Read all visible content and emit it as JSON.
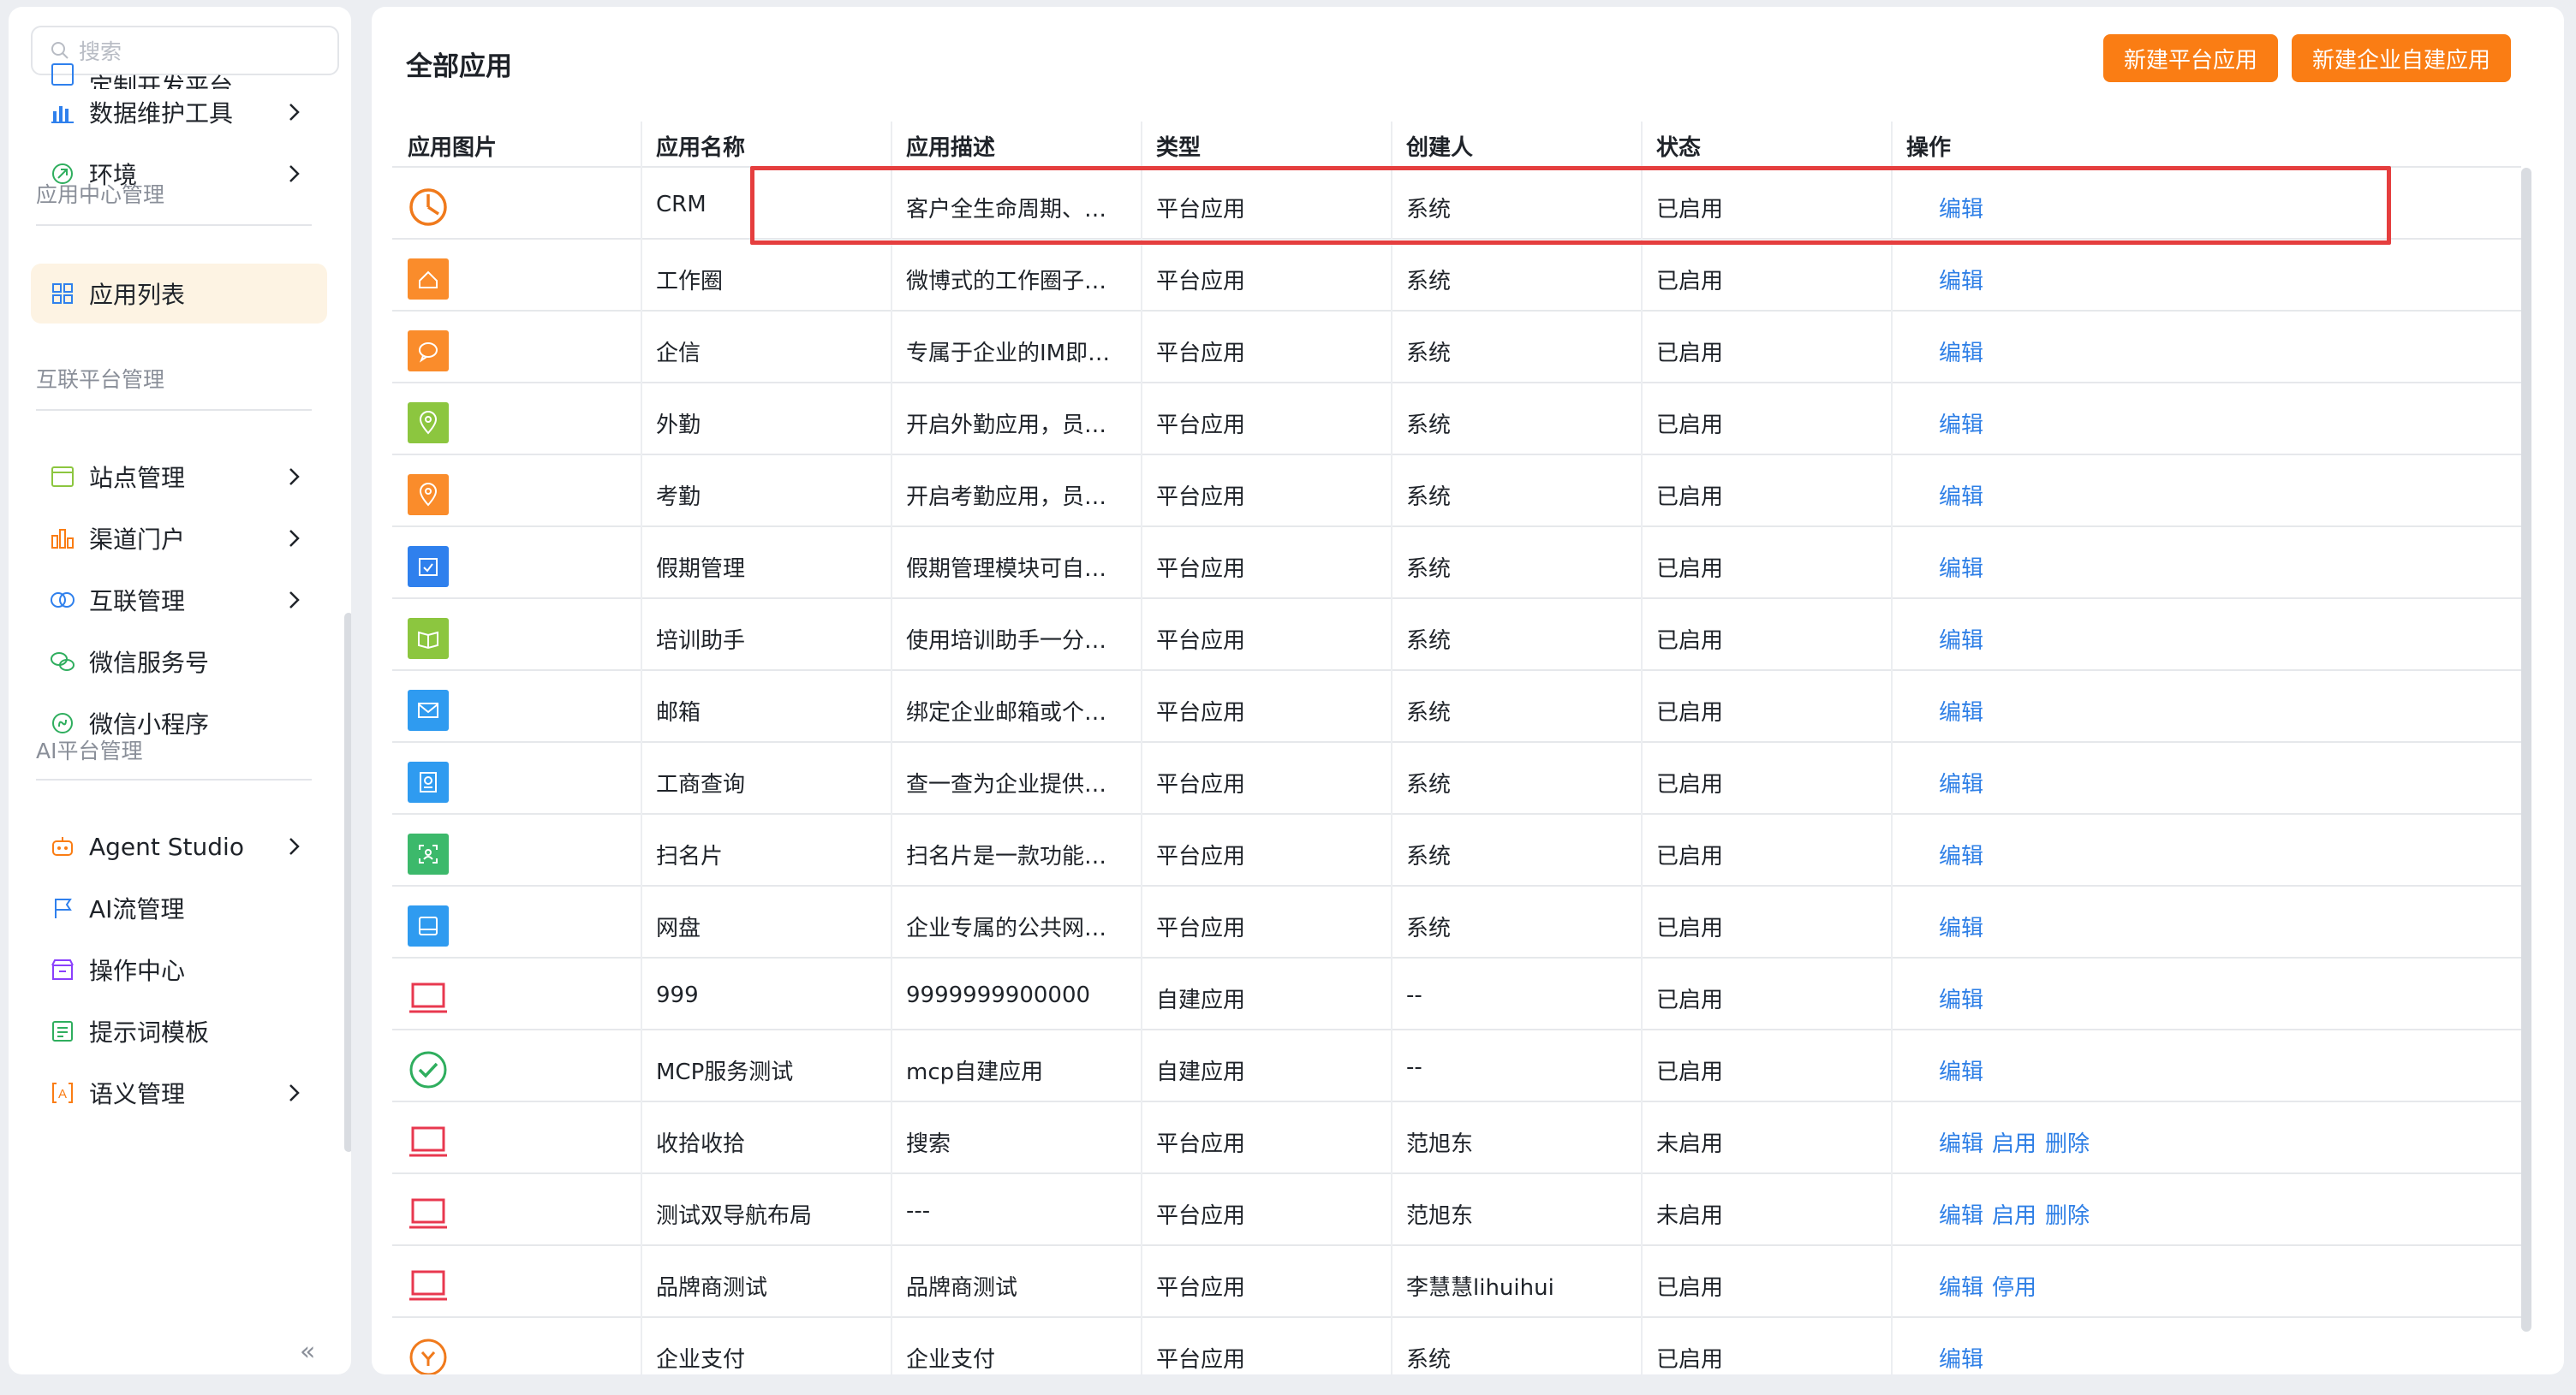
{
  "sidebar": {
    "search_placeholder": "搜索",
    "top_cut_label": "定制开发平台",
    "items_top": [
      {
        "label": "数据维护工具",
        "icon": "bar-chart-icon"
      },
      {
        "label": "环境",
        "icon": "leaf-icon"
      }
    ],
    "section_app_center": "应用中心管理",
    "app_center_items": [
      {
        "label": "应用列表",
        "icon": "grid-icon"
      }
    ],
    "section_interconnect": "互联平台管理",
    "interconnect_items": [
      {
        "label": "站点管理",
        "icon": "window-icon"
      },
      {
        "label": "渠道门户",
        "icon": "columns-icon"
      },
      {
        "label": "互联管理",
        "icon": "link-circles-icon"
      },
      {
        "label": "微信服务号",
        "icon": "wechat-icon"
      },
      {
        "label": "微信小程序",
        "icon": "mini-program-icon"
      }
    ],
    "section_ai": "AI平台管理",
    "ai_items": [
      {
        "label": "Agent Studio",
        "icon": "robot-icon"
      },
      {
        "label": "AI流管理",
        "icon": "flag-icon"
      },
      {
        "label": "操作中心",
        "icon": "store-icon"
      },
      {
        "label": "提示词模板",
        "icon": "template-icon"
      },
      {
        "label": "语义管理",
        "icon": "bracket-a-icon"
      }
    ],
    "collapse_glyph": "«"
  },
  "main": {
    "title": "全部应用",
    "btn_platform": "新建平台应用",
    "btn_enterprise": "新建企业自建应用",
    "columns": [
      "应用图片",
      "应用名称",
      "应用描述",
      "类型",
      "创建人",
      "状态",
      "操作"
    ],
    "rows": [
      {
        "icon": "pie-chart-icon",
        "color": "#f07a1c",
        "name": "CRM",
        "desc": "客户全生命周期、…",
        "type": "平台应用",
        "creator": "系统",
        "status": "已启用",
        "ops": [
          "编辑"
        ]
      },
      {
        "icon": "home-icon",
        "color": "#fa8c2b",
        "name": "工作圈",
        "desc": "微博式的工作圈子…",
        "type": "平台应用",
        "creator": "系统",
        "status": "已启用",
        "ops": [
          "编辑"
        ]
      },
      {
        "icon": "chat-icon",
        "color": "#fa8c2b",
        "name": "企信",
        "desc": "专属于企业的IM即…",
        "type": "平台应用",
        "creator": "系统",
        "status": "已启用",
        "ops": [
          "编辑"
        ]
      },
      {
        "icon": "location-icon",
        "color": "#8cc63f",
        "name": "外勤",
        "desc": "开启外勤应用，员…",
        "type": "平台应用",
        "creator": "系统",
        "status": "已启用",
        "ops": [
          "编辑"
        ]
      },
      {
        "icon": "pin-check-icon",
        "color": "#fa8c2b",
        "name": "考勤",
        "desc": "开启考勤应用，员…",
        "type": "平台应用",
        "creator": "系统",
        "status": "已启用",
        "ops": [
          "编辑"
        ]
      },
      {
        "icon": "calendar-icon",
        "color": "#2f80ed",
        "name": "假期管理",
        "desc": "假期管理模块可自…",
        "type": "平台应用",
        "creator": "系统",
        "status": "已启用",
        "ops": [
          "编辑"
        ]
      },
      {
        "icon": "book-icon",
        "color": "#8cc63f",
        "name": "培训助手",
        "desc": "使用培训助手一分…",
        "type": "平台应用",
        "creator": "系统",
        "status": "已启用",
        "ops": [
          "编辑"
        ]
      },
      {
        "icon": "mail-icon",
        "color": "#2f9bf0",
        "name": "邮箱",
        "desc": "绑定企业邮箱或个…",
        "type": "平台应用",
        "creator": "系统",
        "status": "已启用",
        "ops": [
          "编辑"
        ]
      },
      {
        "icon": "document-search-icon",
        "color": "#2f9bf0",
        "name": "工商查询",
        "desc": "查一查为企业提供…",
        "type": "平台应用",
        "creator": "系统",
        "status": "已启用",
        "ops": [
          "编辑"
        ]
      },
      {
        "icon": "scan-card-icon",
        "color": "#3cb96b",
        "name": "扫名片",
        "desc": "扫名片是一款功能…",
        "type": "平台应用",
        "creator": "系统",
        "status": "已启用",
        "ops": [
          "编辑"
        ]
      },
      {
        "icon": "disk-icon",
        "color": "#2f9bf0",
        "name": "网盘",
        "desc": "企业专属的公共网…",
        "type": "平台应用",
        "creator": "系统",
        "status": "已启用",
        "ops": [
          "编辑"
        ]
      },
      {
        "icon": "laptop-icon",
        "color": "#e8384f",
        "name": "999",
        "desc": "9999999900000",
        "type": "自建应用",
        "creator": "--",
        "status": "已启用",
        "ops": [
          "编辑"
        ]
      },
      {
        "icon": "check-circle-icon",
        "color": "#2fae5e",
        "name": "MCP服务测试",
        "desc": "mcp自建应用",
        "type": "自建应用",
        "creator": "--",
        "status": "已启用",
        "ops": [
          "编辑"
        ]
      },
      {
        "icon": "laptop-icon",
        "color": "#e8384f",
        "name": "收拾收拾",
        "desc": "搜索",
        "type": "平台应用",
        "creator": "范旭东",
        "status": "未启用",
        "ops": [
          "编辑",
          "启用",
          "删除"
        ]
      },
      {
        "icon": "laptop-icon",
        "color": "#e8384f",
        "name": "测试双导航布局",
        "desc": "---",
        "type": "平台应用",
        "creator": "范旭东",
        "status": "未启用",
        "ops": [
          "编辑",
          "启用",
          "删除"
        ]
      },
      {
        "icon": "laptop-icon",
        "color": "#e8384f",
        "name": "品牌商测试",
        "desc": "品牌商测试",
        "type": "平台应用",
        "creator": "李慧慧lihuihui",
        "status": "已启用",
        "ops": [
          "编辑",
          "停用"
        ]
      },
      {
        "icon": "payment-icon",
        "color": "#f07a1c",
        "name": "企业支付",
        "desc": "企业支付",
        "type": "平台应用",
        "creator": "系统",
        "status": "已启用",
        "ops": [
          "编辑"
        ]
      }
    ]
  }
}
